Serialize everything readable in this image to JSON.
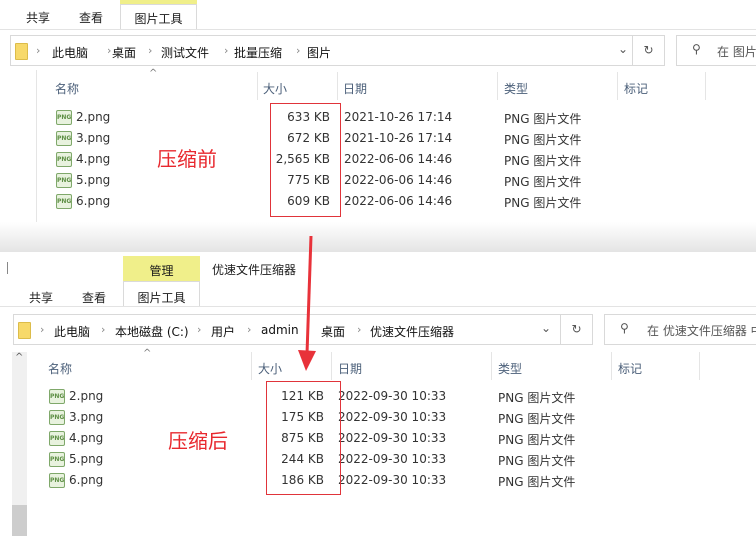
{
  "top": {
    "tabs": [
      "共享",
      "查看"
    ],
    "tool_tab": "图片工具",
    "breadcrumb": [
      "此电脑",
      "桌面",
      "测试文件",
      "批量压缩",
      "图片"
    ],
    "search_placeholder": "在 图片",
    "columns": [
      "名称",
      "大小",
      "日期",
      "类型",
      "标记"
    ],
    "files": [
      {
        "name": "2.png",
        "size": "633 KB",
        "date": "2021-10-26 17:14",
        "type": "PNG 图片文件"
      },
      {
        "name": "3.png",
        "size": "672 KB",
        "date": "2021-10-26 17:14",
        "type": "PNG 图片文件"
      },
      {
        "name": "4.png",
        "size": "2,565 KB",
        "date": "2022-06-06 14:46",
        "type": "PNG 图片文件"
      },
      {
        "name": "5.png",
        "size": "775 KB",
        "date": "2022-06-06 14:46",
        "type": "PNG 图片文件"
      },
      {
        "name": "6.png",
        "size": "609 KB",
        "date": "2022-06-06 14:46",
        "type": "PNG 图片文件"
      }
    ],
    "annotation": "压缩前"
  },
  "bottom": {
    "context_tab": "管理",
    "window_title": "优速文件压缩器",
    "tabs": [
      "共享",
      "查看"
    ],
    "tool_tab": "图片工具",
    "breadcrumb": [
      "此电脑",
      "本地磁盘 (C:)",
      "用户",
      "admin",
      "桌面",
      "优速文件压缩器"
    ],
    "search_placeholder": "在 优速文件压缩器 中",
    "columns": [
      "名称",
      "大小",
      "日期",
      "类型",
      "标记"
    ],
    "files": [
      {
        "name": "2.png",
        "size": "121 KB",
        "date": "2022-09-30 10:33",
        "type": "PNG 图片文件"
      },
      {
        "name": "3.png",
        "size": "175 KB",
        "date": "2022-09-30 10:33",
        "type": "PNG 图片文件"
      },
      {
        "name": "4.png",
        "size": "875 KB",
        "date": "2022-09-30 10:33",
        "type": "PNG 图片文件"
      },
      {
        "name": "5.png",
        "size": "244 KB",
        "date": "2022-09-30 10:33",
        "type": "PNG 图片文件"
      },
      {
        "name": "6.png",
        "size": "186 KB",
        "date": "2022-09-30 10:33",
        "type": "PNG 图片文件"
      }
    ],
    "annotation": "压缩后"
  },
  "icons": {
    "png": "PNG"
  },
  "colors": {
    "annotation": "#e8282e",
    "context_tab": "#f0ef8a"
  }
}
